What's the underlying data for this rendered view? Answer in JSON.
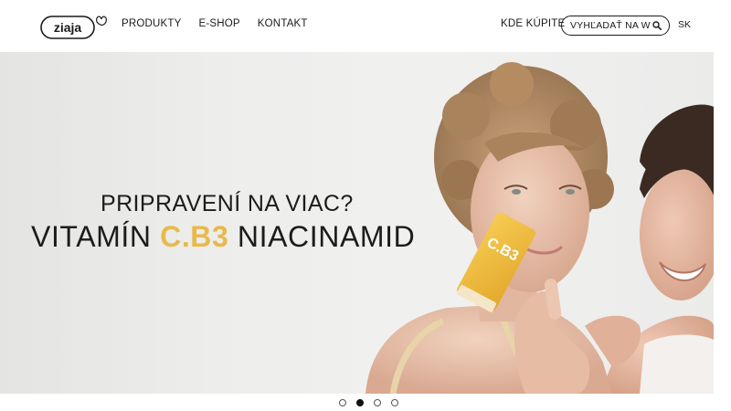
{
  "brand": {
    "logo_text": "ziaja"
  },
  "nav": {
    "items": [
      {
        "label": "PRODUKTY"
      },
      {
        "label": "E-SHOP"
      },
      {
        "label": "KONTAKT"
      }
    ],
    "where_to_buy": "KDE KÚPITE",
    "search_placeholder": "VYHĽADAŤ NA WEBE",
    "language": "SK"
  },
  "hero": {
    "subtitle": "PRIPRAVENÍ NA VIAC?",
    "title_prefix": "VITAMÍN ",
    "title_accent": "C.B3",
    "title_suffix": " NIACINAMID",
    "product_label": "C.B3",
    "accent_color": "#e9b949"
  },
  "carousel": {
    "slide_count": 4,
    "active_index": 1
  },
  "icons": {
    "search": "search-icon"
  }
}
